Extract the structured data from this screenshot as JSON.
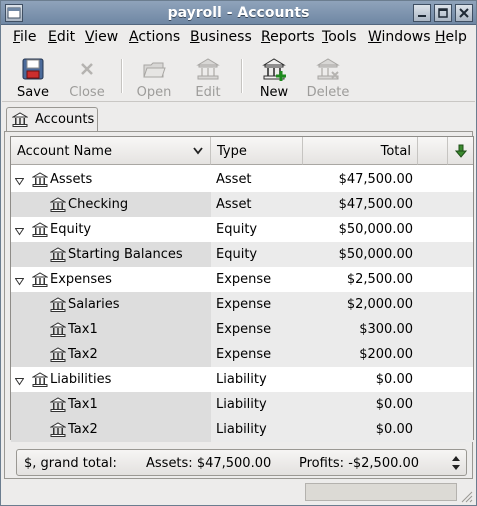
{
  "window": {
    "title": "payroll - Accounts"
  },
  "menu": [
    {
      "prefix": "",
      "ul": "F",
      "rest": "ile"
    },
    {
      "prefix": "",
      "ul": "E",
      "rest": "dit"
    },
    {
      "prefix": "",
      "ul": "V",
      "rest": "iew"
    },
    {
      "prefix": "",
      "ul": "A",
      "rest": "ctions"
    },
    {
      "prefix": "",
      "ul": "B",
      "rest": "usiness"
    },
    {
      "prefix": "",
      "ul": "R",
      "rest": "eports"
    },
    {
      "prefix": "",
      "ul": "T",
      "rest": "ools"
    },
    {
      "prefix": "",
      "ul": "W",
      "rest": "indows"
    },
    {
      "prefix": "",
      "ul": "H",
      "rest": "elp"
    }
  ],
  "toolbar": {
    "save": "Save",
    "close": "Close",
    "open": "Open",
    "edit": "Edit",
    "new": "New",
    "delete": "Delete"
  },
  "tab": {
    "label": "Accounts"
  },
  "columns": {
    "name": "Account Name",
    "type": "Type",
    "total": "Total"
  },
  "rows": [
    {
      "name": "Assets",
      "type": "Asset",
      "total": "$47,500.00",
      "level": 0,
      "expanded": true
    },
    {
      "name": "Checking",
      "type": "Asset",
      "total": "$47,500.00",
      "level": 1
    },
    {
      "name": "Equity",
      "type": "Equity",
      "total": "$50,000.00",
      "level": 0,
      "expanded": true
    },
    {
      "name": "Starting Balances",
      "type": "Equity",
      "total": "$50,000.00",
      "level": 1
    },
    {
      "name": "Expenses",
      "type": "Expense",
      "total": "$2,500.00",
      "level": 0,
      "expanded": true
    },
    {
      "name": "Salaries",
      "type": "Expense",
      "total": "$2,000.00",
      "level": 1
    },
    {
      "name": "Tax1",
      "type": "Expense",
      "total": "$300.00",
      "level": 1
    },
    {
      "name": "Tax2",
      "type": "Expense",
      "total": "$200.00",
      "level": 1
    },
    {
      "name": "Liabilities",
      "type": "Liability",
      "total": "$0.00",
      "level": 0,
      "expanded": true
    },
    {
      "name": "Tax1",
      "type": "Liability",
      "total": "$0.00",
      "level": 1
    },
    {
      "name": "Tax2",
      "type": "Liability",
      "total": "$0.00",
      "level": 1
    }
  ],
  "summary": {
    "currency": "$, grand total:",
    "assets": "Assets: $47,500.00",
    "profits": "Profits: -$2,500.00"
  }
}
